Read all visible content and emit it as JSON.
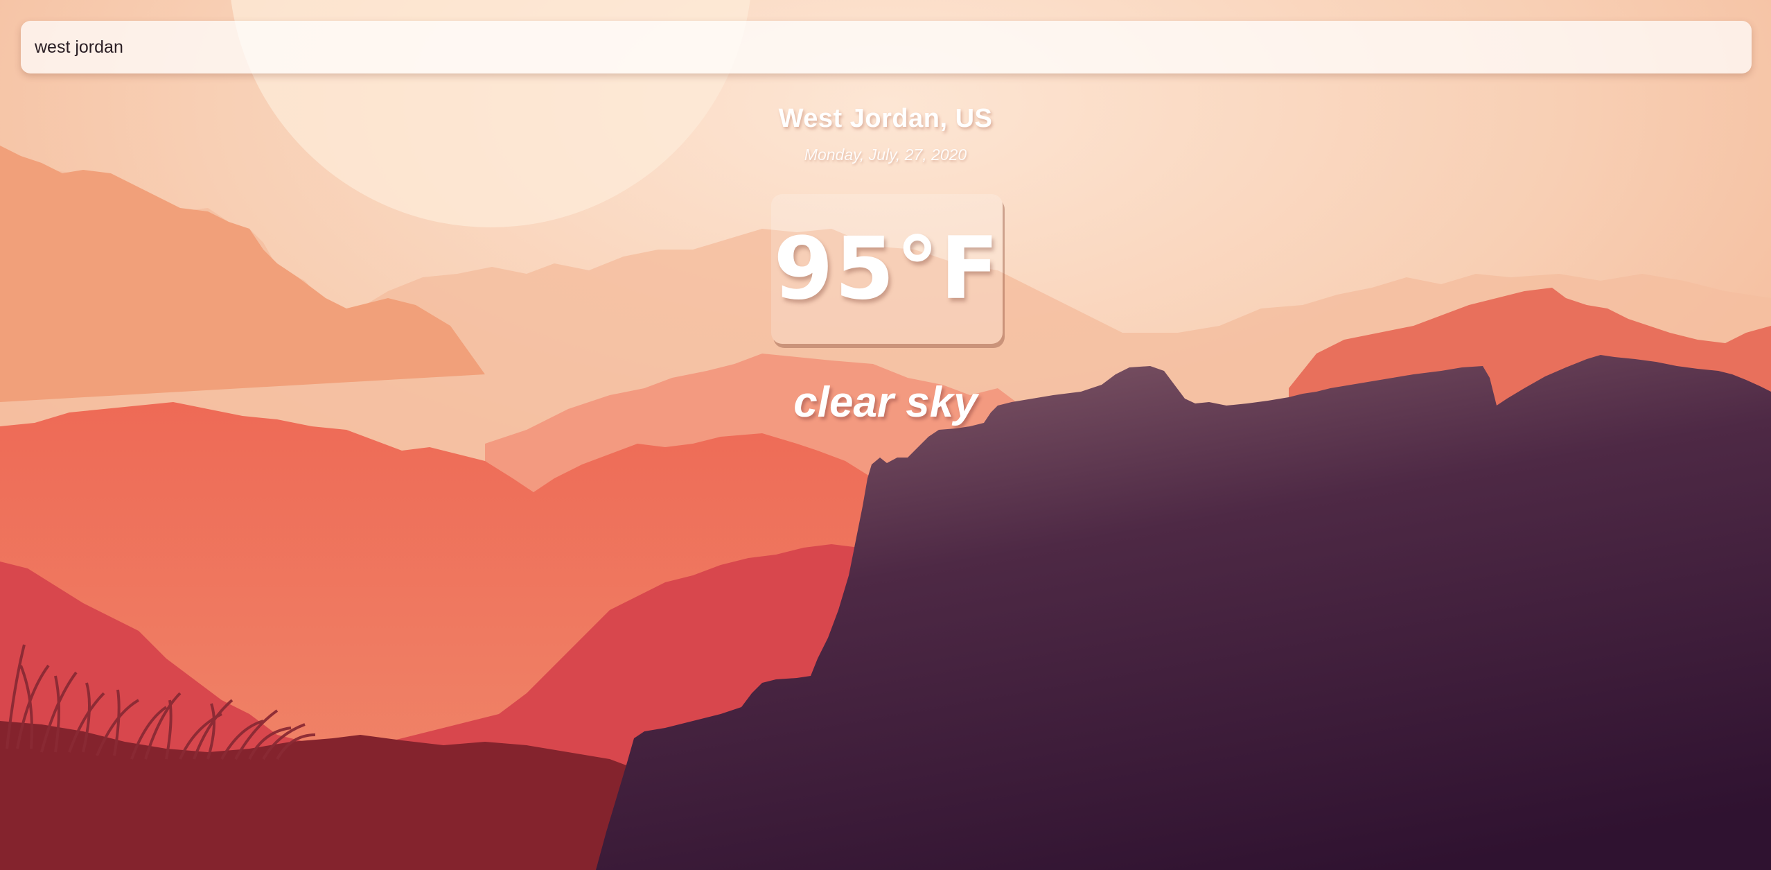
{
  "search": {
    "value": "west jordan"
  },
  "weather": {
    "location": "West Jordan, US",
    "date": "Monday, July, 27, 2020",
    "temperature": "95°F",
    "condition": "clear sky"
  },
  "colors": {
    "sky_top": "#f6c4a4",
    "sun": "#fdebd8",
    "far_ridge": "#f3b996",
    "mid_ridge": "#ee7a63",
    "near_ridge": "#d23d45",
    "foreground_dark": "#2f1230",
    "foreground_red": "#84232d"
  },
  "icons": [
    "sun-shape",
    "mountain-silhouette",
    "grass-silhouette"
  ]
}
